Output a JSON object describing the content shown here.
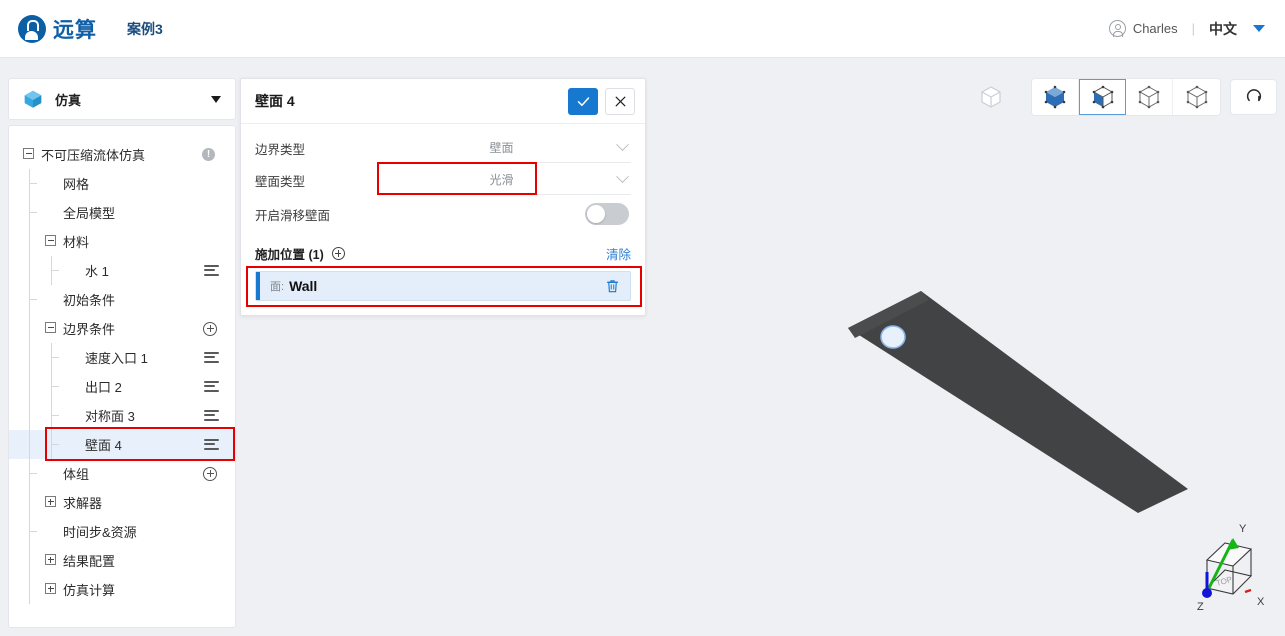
{
  "header": {
    "logo_text": "远算",
    "logo_icon": "yuansuan-logo-icon",
    "case_name": "案例3",
    "user_icon": "user-avatar-icon",
    "user_name": "Charles",
    "separator": "|",
    "language": "中文",
    "caret_icon": "chevron-down-icon"
  },
  "sidebar": {
    "icon": "cube-icon",
    "title": "仿真",
    "collapse_icon": "chevron-down-icon",
    "tree": [
      {
        "label": "不可压缩流体仿真",
        "depth": 0,
        "toggle": "minus",
        "right": "info",
        "selected": false
      },
      {
        "label": "网格",
        "depth": 1,
        "toggle": "none",
        "right": "none",
        "selected": false
      },
      {
        "label": "全局模型",
        "depth": 1,
        "toggle": "none",
        "right": "none",
        "selected": false
      },
      {
        "label": "材料",
        "depth": 1,
        "toggle": "minus",
        "right": "none",
        "selected": false
      },
      {
        "label": "水 1",
        "depth": 2,
        "toggle": "none",
        "right": "menu",
        "selected": false
      },
      {
        "label": "初始条件",
        "depth": 1,
        "toggle": "none",
        "right": "none",
        "selected": false
      },
      {
        "label": "边界条件",
        "depth": 1,
        "toggle": "minus",
        "right": "plus",
        "selected": false
      },
      {
        "label": "速度入口 1",
        "depth": 2,
        "toggle": "none",
        "right": "menu",
        "selected": false
      },
      {
        "label": "出口 2",
        "depth": 2,
        "toggle": "none",
        "right": "menu",
        "selected": false
      },
      {
        "label": "对称面 3",
        "depth": 2,
        "toggle": "none",
        "right": "menu",
        "selected": false
      },
      {
        "label": "壁面 4",
        "depth": 2,
        "toggle": "none",
        "right": "menu",
        "selected": true
      },
      {
        "label": "体组",
        "depth": 1,
        "toggle": "none",
        "right": "plus",
        "selected": false
      },
      {
        "label": "求解器",
        "depth": 1,
        "toggle": "plus",
        "right": "none",
        "selected": false
      },
      {
        "label": "时间步&资源",
        "depth": 1,
        "toggle": "none",
        "right": "none",
        "selected": false
      },
      {
        "label": "结果配置",
        "depth": 1,
        "toggle": "plus",
        "right": "none",
        "selected": false
      },
      {
        "label": "仿真计算",
        "depth": 1,
        "toggle": "plus",
        "right": "none",
        "selected": false
      }
    ]
  },
  "panel": {
    "title": "壁面 4",
    "confirm_icon": "check-icon",
    "close_icon": "close-icon",
    "fields": [
      {
        "label": "边界类型",
        "value": "壁面",
        "chevron": "chevron-down-icon",
        "highlighted": false
      },
      {
        "label": "壁面类型",
        "value": "光滑",
        "chevron": "chevron-down-icon",
        "highlighted": true
      }
    ],
    "toggle_field": {
      "label": "开启滑移壁面",
      "state": "off"
    },
    "section": {
      "title": "施加位置 (1)",
      "add_icon": "plus-circle-icon",
      "clear_label": "清除",
      "items": [
        {
          "prefix": "面:",
          "name": "Wall",
          "delete_icon": "trash-icon"
        }
      ]
    }
  },
  "viewport": {
    "toolbar": [
      {
        "name": "cube-outline-disabled-icon",
        "state": "disabled",
        "group": "ghost"
      },
      {
        "name": "cube-front-view-icon",
        "state": "normal",
        "group": "main"
      },
      {
        "name": "cube-iso-view-icon",
        "state": "active",
        "group": "main"
      },
      {
        "name": "cube-wire-view-icon",
        "state": "normal",
        "group": "main"
      },
      {
        "name": "cube-wire2-view-icon",
        "state": "normal",
        "group": "main"
      },
      {
        "name": "reset-rotate-icon",
        "state": "normal",
        "group": "single"
      }
    ],
    "model": {
      "name": "wall-plate-model",
      "body_color": "#414345",
      "hole_color": "#e8f0fb",
      "background": "#eef0f4"
    },
    "axis_triad": {
      "name": "axis-triad-widget",
      "face_label": "TOP",
      "x_label": "X",
      "y_label": "Y",
      "z_label": "Z",
      "x_color": "#d81f1f",
      "y_color": "#16b516",
      "z_color": "#1414d8"
    }
  },
  "colors": {
    "accent_blue": "#1778d0",
    "highlight_red": "#e60000",
    "selection_blue": "#e8f1fb",
    "panel_bg": "#ffffff",
    "app_bg": "#eef0f4"
  }
}
